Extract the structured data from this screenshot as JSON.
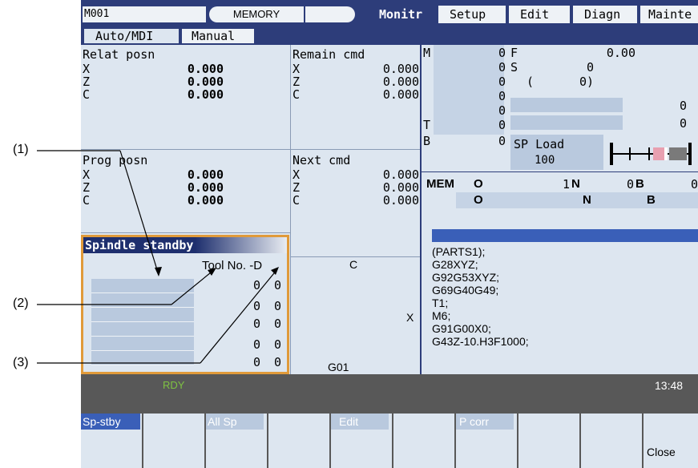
{
  "header": {
    "machine": "M001",
    "mode": "MEMORY",
    "tabs": [
      "Monitr",
      "Setup",
      "Edit",
      "Diagn",
      "Mainte"
    ],
    "subtabs": [
      "Auto/MDI",
      "Manual"
    ]
  },
  "relat_posn": {
    "title": "Relat posn",
    "axes": [
      "X",
      "Z",
      "C"
    ],
    "values": [
      "0.000",
      "0.000",
      "0.000"
    ]
  },
  "remain_cmd": {
    "title": "Remain cmd",
    "axes": [
      "X",
      "Z",
      "C"
    ],
    "values": [
      "0.000",
      "0.000",
      "0.000"
    ]
  },
  "prog_posn": {
    "title": "Prog posn",
    "axes": [
      "X",
      "Z",
      "C"
    ],
    "values": [
      "0.000",
      "0.000",
      "0.000"
    ]
  },
  "next_cmd": {
    "title": "Next cmd",
    "axes": [
      "X",
      "Z",
      "C"
    ],
    "values": [
      "0.000",
      "0.000",
      "0.000"
    ]
  },
  "mst": {
    "m_label": "M",
    "t_label": "T",
    "b_label": "B",
    "m_values": [
      "0",
      "0",
      "0",
      "0",
      "0"
    ],
    "t_value": "0",
    "b_value": "0",
    "f_label": "F",
    "f_value": "0.00",
    "s_label": "S",
    "s_value": "0",
    "s_paren": "(",
    "s_paren_value": "0)",
    "aux_values": [
      "0",
      "0"
    ],
    "sp_load_label": "SP Load",
    "sp_load_value": "100"
  },
  "prog_info": {
    "mem_label": "MEM",
    "o_label": "O",
    "o_value": "1",
    "n_label": "N",
    "n_value": "0",
    "b_label": "B",
    "b_value": "0",
    "o2_label": "O",
    "n2_label": "N",
    "b2_label": "B"
  },
  "program_lines": [
    "(PARTS1);",
    "G28XYZ;",
    "G92G53XYZ;",
    "G69G40G49;",
    "T1;",
    "M6;",
    "G91G00X0;",
    "G43Z-10.H3F1000;"
  ],
  "graph": {
    "c_label": "C",
    "x_label": "X",
    "g_label": "G01"
  },
  "spindle_standby": {
    "title": "Spindle standby",
    "header": "Tool No. -D",
    "rows": [
      [
        "0",
        "0"
      ],
      [
        "0",
        "0"
      ],
      [
        "0",
        "0"
      ],
      [
        "0",
        "0"
      ],
      [
        "0",
        "0"
      ]
    ]
  },
  "status": {
    "ready": "RDY",
    "time": "13:48"
  },
  "softkeys": [
    "Sp-stby",
    "",
    "All Sp",
    "",
    "Edit",
    "",
    "P corr",
    "",
    "",
    "Close"
  ],
  "callouts": [
    "(1)",
    "(2)",
    "(3)"
  ]
}
